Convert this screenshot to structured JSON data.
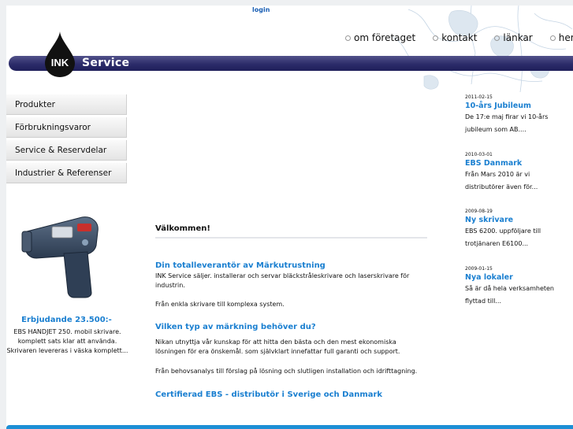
{
  "header": {
    "login_label": "login",
    "logo_ink": "INK",
    "logo_service": "Service",
    "nav": [
      "om företaget",
      "kontakt",
      "länkar",
      "hem"
    ]
  },
  "sidebar": {
    "items": [
      "Produkter",
      "Förbrukningsvaror",
      "Service & Reservdelar",
      "Industrier & Referenser"
    ]
  },
  "promo": {
    "title": "Erbjudande 23.500:-",
    "text": "EBS HANDJET 250. mobil skrivare. komplett sats klar att använda. Skrivaren levereras i väska komplett..."
  },
  "main": {
    "welcome": "Välkommen!",
    "section1_title": "Din totalleverantör av Märkutrustning",
    "section1_p1": "INK Service säljer. installerar och servar bläckstråleskrivare och laserskrivare för industrin.",
    "section1_p2": "Från enkla skrivare till komplexa system.",
    "section2_title": "Vilken typ av märkning behöver du?",
    "section2_p1": "Nikan utnyttja vår kunskap för att hitta den bästa och den mest ekonomiska lösningen för era önskemål. som självklart innefattar full garanti och support.",
    "section2_p2": "Från behovsanalys till förslag på lösning och slutligen installation och idrifttagning.",
    "section3_title": "Certifierad EBS - distributör i Sverige och Danmark"
  },
  "news": [
    {
      "date": "2011-02-15",
      "title": "10-års Jubileum",
      "line1": "De 17:e maj firar vi 10-års",
      "line2": "jubileum som AB...."
    },
    {
      "date": "2010-03-01",
      "title": "EBS Danmark",
      "line1": "Från Mars 2010 är vi",
      "line2": "distributörer även för..."
    },
    {
      "date": "2009-08-19",
      "title": "Ny skrivare",
      "line1": "EBS 6200. uppföljare till",
      "line2": "trotjänaren E6100..."
    },
    {
      "date": "2009-01-15",
      "title": "Nya lokaler",
      "line1": "Så är då hela verksamheten",
      "line2": "flyttad till..."
    }
  ],
  "colors": {
    "accent_blue": "#1a7fd0",
    "banner_navy": "#2c2c6a",
    "footer_blue": "#1d8fd5"
  },
  "icons": {
    "logo": "ink-drop-logo",
    "nav_bullet": "circle-bullet-icon",
    "promo": "handheld-printer-image"
  }
}
